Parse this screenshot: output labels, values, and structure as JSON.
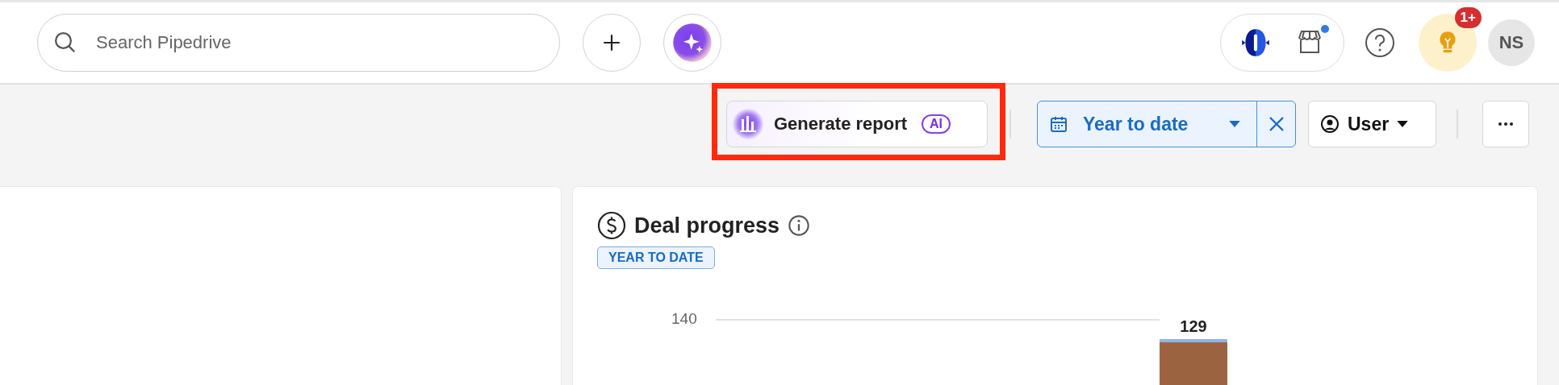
{
  "topbar": {
    "search": {
      "placeholder": "Search Pipedrive"
    },
    "marketplace": {
      "notification": true
    },
    "tips": {
      "badge": "1+"
    },
    "avatar": {
      "initials": "NS"
    }
  },
  "toolbar": {
    "generate_report": {
      "label": "Generate report",
      "tag": "AI",
      "highlighted": true
    },
    "period": {
      "label": "Year to date"
    },
    "user_filter": {
      "label": "User"
    }
  },
  "cards": [
    {
      "kind": "empty"
    },
    {
      "kind": "chart",
      "title": "Deal progress",
      "badge": "YEAR TO DATE",
      "gridline_label": "140",
      "bar_label": "129"
    }
  ]
}
